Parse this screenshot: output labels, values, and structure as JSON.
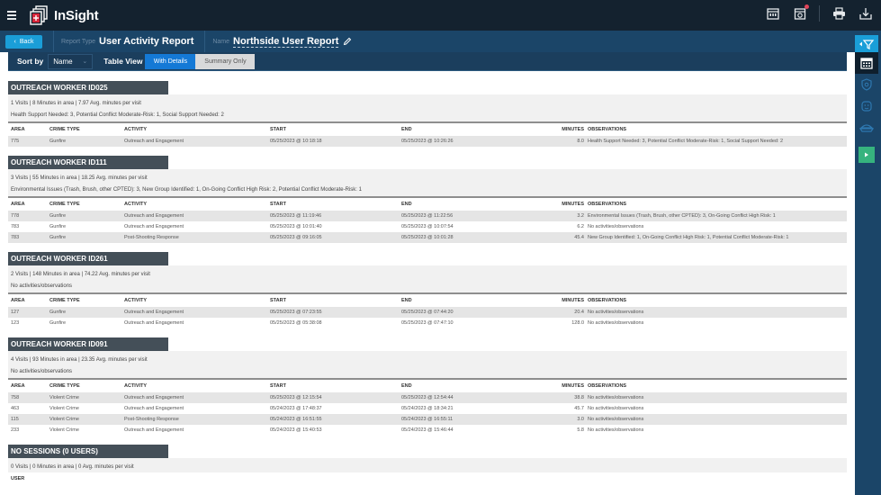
{
  "app": {
    "name": "InSight"
  },
  "top_actions": [
    "calendar-icon",
    "camera-icon",
    "print-icon",
    "download-icon"
  ],
  "header": {
    "back_label": "Back",
    "report_type_label": "Report Type",
    "report_type_value": "User Activity Report",
    "name_label": "Name",
    "name_value": "Northside User Report"
  },
  "toolbar": {
    "sort_label": "Sort by",
    "sort_value": "Name",
    "table_view_label": "Table View",
    "view_options": [
      "With Details",
      "Summary Only"
    ],
    "active_view": "With Details"
  },
  "columns": [
    "AREA",
    "CRIME TYPE",
    "ACTIVITY",
    "START",
    "END",
    "MINUTES",
    "OBSERVATIONS"
  ],
  "sections": [
    {
      "title": "OUTREACH WORKER ID025",
      "summary": "1 Visits | 8 Minutes in area | 7.97 Avg. minutes per visit",
      "observations": "Health Support Needed: 3, Potential Conflict Moderate-Risk: 1, Social Support Needed: 2",
      "rows": [
        [
          "775",
          "Gunfire",
          "Outreach and Engagement",
          "05/25/2023 @ 10:18:18",
          "05/25/2023 @ 10:26:26",
          "8.0",
          "Health Support Needed: 3, Potential Conflict Moderate-Risk: 1, Social Support Needed: 2"
        ]
      ]
    },
    {
      "title": "OUTREACH WORKER ID111",
      "summary": "3 Visits | 55 Minutes in area | 18.25 Avg. minutes per visit",
      "observations": "Environmental Issues (Trash, Brush, other CPTED): 3, New Group Identified: 1, On-Going Conflict High Risk: 2, Potential Conflict Moderate-Risk: 1",
      "rows": [
        [
          "778",
          "Gunfire",
          "Outreach and Engagement",
          "05/25/2023 @ 11:19:46",
          "05/25/2023 @ 11:22:56",
          "3.2",
          "Environmental Issues (Trash, Brush, other CPTED): 3, On-Going Conflict High Risk: 1"
        ],
        [
          "783",
          "Gunfire",
          "Outreach and Engagement",
          "05/25/2023 @ 10:01:40",
          "05/25/2023 @ 10:07:54",
          "6.2",
          "No activities/observations"
        ],
        [
          "783",
          "Gunfire",
          "Post-Shooting Response",
          "05/25/2023 @ 09:16:05",
          "05/25/2023 @ 10:01:28",
          "45.4",
          "New Group Identified: 1, On-Going Conflict High Risk: 1, Potential Conflict Moderate-Risk: 1"
        ]
      ]
    },
    {
      "title": "OUTREACH WORKER ID261",
      "summary": "2 Visits | 148 Minutes in area | 74.22 Avg. minutes per visit",
      "observations": "No activities/observations",
      "rows": [
        [
          "127",
          "Gunfire",
          "Outreach and Engagement",
          "05/25/2023 @ 07:23:55",
          "05/25/2023 @ 07:44:20",
          "20.4",
          "No activities/observations"
        ],
        [
          "123",
          "Gunfire",
          "Outreach and Engagement",
          "05/25/2023 @ 05:38:08",
          "05/25/2023 @ 07:47:10",
          "128.0",
          "No activities/observations"
        ]
      ]
    },
    {
      "title": "OUTREACH WORKER ID091",
      "summary": "4 Visits | 93 Minutes in area | 23.35 Avg. minutes per visit",
      "observations": "No activities/observations",
      "rows": [
        [
          "758",
          "Violent Crime",
          "Outreach and Engagement",
          "05/25/2023 @ 12:15:54",
          "05/25/2023 @ 12:54:44",
          "38.8",
          "No activities/observations"
        ],
        [
          "463",
          "Violent Crime",
          "Outreach and Engagement",
          "05/24/2023 @ 17:48:37",
          "05/24/2023 @ 18:34:21",
          "45.7",
          "No activities/observations"
        ],
        [
          "115",
          "Violent Crime",
          "Post-Shooting Response",
          "05/24/2023 @ 16:51:55",
          "05/24/2023 @ 16:55:11",
          "3.0",
          "No activities/observations"
        ],
        [
          "233",
          "Violent Crime",
          "Outreach and Engagement",
          "05/24/2023 @ 15:40:53",
          "05/24/2023 @ 15:46:44",
          "5.8",
          "No activities/observations"
        ]
      ]
    }
  ],
  "no_sessions": {
    "title": "NO SESSIONS (0 USERS)",
    "summary": "0 Visits | 0 Minutes in area | 0 Avg. minutes per visit",
    "column": "USER"
  },
  "right_sidebar": [
    "filter-toggle",
    "calendar",
    "shield-badge",
    "officer-face",
    "police-cap",
    "expand"
  ]
}
